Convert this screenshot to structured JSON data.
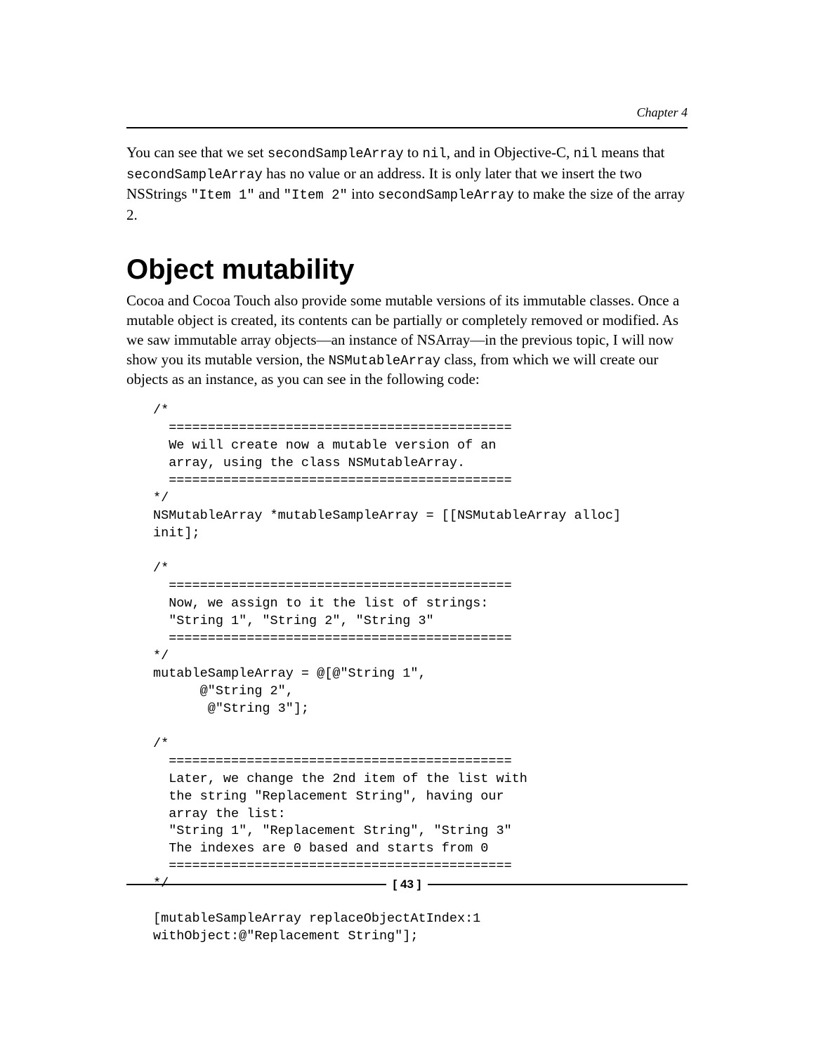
{
  "header": {
    "chapter_label": "Chapter 4"
  },
  "intro": {
    "t1": "You can see that we set ",
    "c1": "secondSampleArray",
    "t2": " to ",
    "c2": "nil",
    "t3": ", and in Objective-C, ",
    "c3": "nil",
    "t4": " means that ",
    "c4": "secondSampleArray",
    "t5": " has no value or an address. It is only later that we insert the two NSStrings ",
    "c5": "\"Item 1\"",
    "t6": " and ",
    "c6": "\"Item 2\"",
    "t7": " into ",
    "c7": "secondSampleArray",
    "t8": " to make the size of the array 2."
  },
  "section": {
    "heading": "Object mutability",
    "p1a": "Cocoa and Cocoa Touch also provide some mutable versions of its immutable classes. Once a mutable object is created, its contents can be partially or completely removed or modified. As we saw immutable array objects—an instance of NSArray—in the previous topic, I will now show you its mutable version, the ",
    "p1_code": "NSMutableArray",
    "p1b": " class, from which we will create our objects as an instance, as you can see in the following code:"
  },
  "code": "/*\n  ============================================\n  We will create now a mutable version of an\n  array, using the class NSMutableArray.\n  ============================================\n*/\nNSMutableArray *mutableSampleArray = [[NSMutableArray alloc]\ninit];\n\n/*\n  ============================================\n  Now, we assign to it the list of strings:\n  \"String 1\", \"String 2\", \"String 3\"\n  ============================================\n*/\nmutableSampleArray = @[@\"String 1\",\n      @\"String 2\",\n       @\"String 3\"];\n\n/*\n  ============================================\n  Later, we change the 2nd item of the list with\n  the string \"Replacement String\", having our\n  array the list:\n  \"String 1\", \"Replacement String\", \"String 3\"\n  The indexes are 0 based and starts from 0\n  ============================================\n*/\n\n[mutableSampleArray replaceObjectAtIndex:1\nwithObject:@\"Replacement String\"];",
  "footer": {
    "page_number": "[ 43 ]"
  }
}
